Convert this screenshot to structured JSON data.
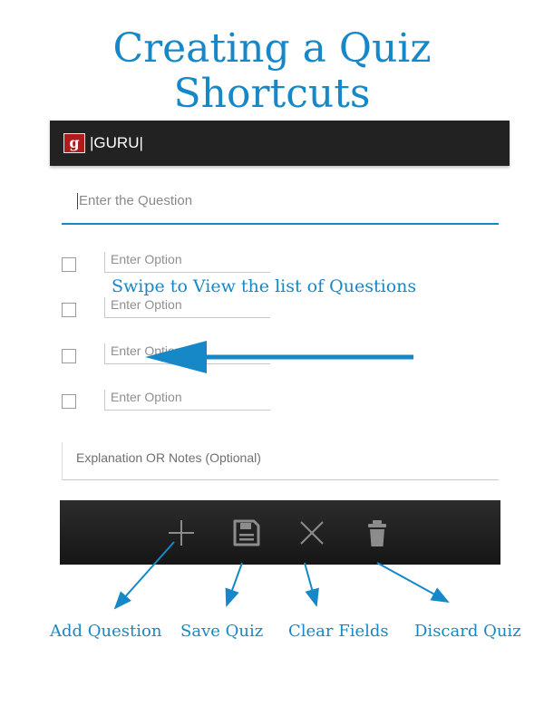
{
  "header": {
    "title_line1": "Creating a Quiz",
    "title_line2": "Shortcuts"
  },
  "app_bar": {
    "logo_letter": "g",
    "title": "|GURU|"
  },
  "form": {
    "question_placeholder": "Enter the Question",
    "options": [
      {
        "placeholder": "Enter Option",
        "checked": false
      },
      {
        "placeholder": "Enter Option",
        "checked": false
      },
      {
        "placeholder": "Enter Option",
        "checked": false
      },
      {
        "placeholder": "Enter Option",
        "checked": false
      }
    ],
    "notes_placeholder": "Explanation OR Notes (Optional)"
  },
  "annotation": {
    "swipe_text": "Swipe to View the list of Questions",
    "accent_color": "#1688c7"
  },
  "action_bar": {
    "buttons": [
      {
        "icon": "plus-icon",
        "label": "Add Question"
      },
      {
        "icon": "save-icon",
        "label": "Save Quiz"
      },
      {
        "icon": "close-icon",
        "label": "Clear Fields"
      },
      {
        "icon": "trash-icon",
        "label": "Discard Quiz"
      }
    ]
  }
}
